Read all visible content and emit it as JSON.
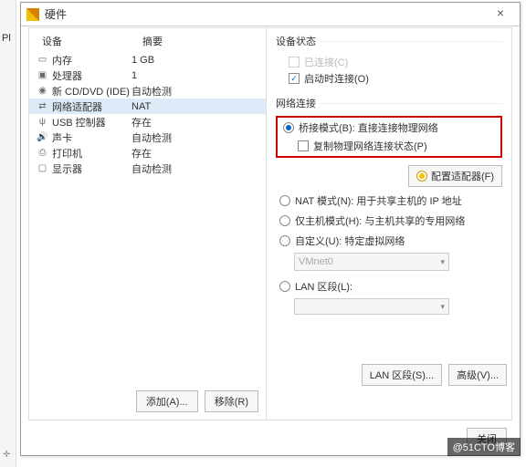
{
  "titlebar": {
    "title": "硬件"
  },
  "leftStrip": {
    "pl": "Pl"
  },
  "columns": {
    "device": "设备",
    "summary": "摘要"
  },
  "devices": [
    {
      "name": "内存",
      "summary": "1 GB",
      "icon": "memory-icon"
    },
    {
      "name": "处理器",
      "summary": "1",
      "icon": "cpu-icon"
    },
    {
      "name": "新 CD/DVD (IDE)",
      "summary": "自动检测",
      "icon": "cd-icon"
    },
    {
      "name": "网络适配器",
      "summary": "NAT",
      "icon": "network-icon",
      "selected": true
    },
    {
      "name": "USB 控制器",
      "summary": "存在",
      "icon": "usb-icon"
    },
    {
      "name": "声卡",
      "summary": "自动检测",
      "icon": "sound-icon"
    },
    {
      "name": "打印机",
      "summary": "存在",
      "icon": "printer-icon"
    },
    {
      "name": "显示器",
      "summary": "自动检测",
      "icon": "display-icon"
    }
  ],
  "leftButtons": {
    "add": "添加(A)...",
    "remove": "移除(R)"
  },
  "deviceStatus": {
    "title": "设备状态",
    "connected": {
      "label": "已连接(C)",
      "checked": false,
      "disabled": true
    },
    "connectAtPowerOn": {
      "label": "启动时连接(O)",
      "checked": true
    }
  },
  "netConn": {
    "title": "网络连接",
    "bridged": {
      "label": "桥接模式(B): 直接连接物理网络",
      "selected": true
    },
    "replicate": {
      "label": "复制物理网络连接状态(P)",
      "checked": false
    },
    "configAdapter": "配置适配器(F)",
    "nat": {
      "label": "NAT 模式(N): 用于共享主机的 IP 地址"
    },
    "hostOnly": {
      "label": "仅主机模式(H): 与主机共享的专用网络"
    },
    "custom": {
      "label": "自定义(U): 特定虚拟网络"
    },
    "customNet": "VMnet0",
    "lan": {
      "label": "LAN 区段(L):"
    }
  },
  "bottomRight": {
    "lanSeg": "LAN 区段(S)...",
    "advanced": "高级(V)..."
  },
  "footer": {
    "close": "关闭"
  },
  "watermark": "@51CTO博客"
}
